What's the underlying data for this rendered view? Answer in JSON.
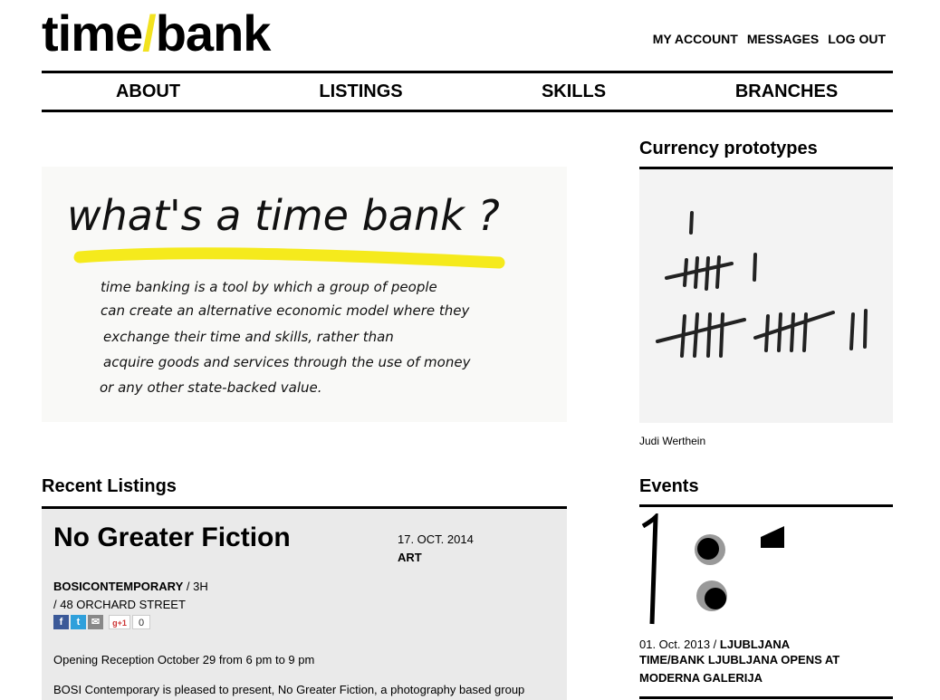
{
  "logo": {
    "part1": "time",
    "slash": "/",
    "part2": "bank"
  },
  "top_links": [
    "MY ACCOUNT",
    "MESSAGES",
    "LOG OUT"
  ],
  "nav": [
    "ABOUT",
    "LISTINGS",
    "SKILLS",
    "BRANCHES"
  ],
  "hero": {
    "heading": "what's a time bank ?",
    "lines": [
      "time banking is a tool by which a group of people",
      "can create an alternative economic model where they",
      "exchange their time and skills, rather than",
      "acquire goods and services through the use of money",
      "or any other state-backed value."
    ]
  },
  "currency": {
    "title": "Currency prototypes",
    "caption": "Judi Werthein"
  },
  "recent_listings": {
    "title": "Recent Listings",
    "item": {
      "heading": "No Greater Fiction",
      "date": "17. OCT. 2014",
      "category": "ART",
      "venue": "BOSICONTEMPORARY",
      "venue_rest": " / 3H",
      "address": "/ 48 ORCHARD STREET",
      "share_count": "0",
      "gplus": "g+1",
      "p1": "Opening Reception October 29 from 6 pm to 9 pm",
      "p2": "BOSI Contemporary is pleased to present, No Greater Fiction, a photography based group"
    }
  },
  "events": {
    "title": "Events",
    "date": "01. Oct. 2013",
    "sep": " / ",
    "city": "LJUBLJANA",
    "headline": "TIME/BANK LJUBLJANA OPENS AT MODERNA GALERIJA"
  },
  "colors": {
    "accent": "#f2e21f",
    "rule": "#000000",
    "listing_bg": "#eaeaea"
  }
}
